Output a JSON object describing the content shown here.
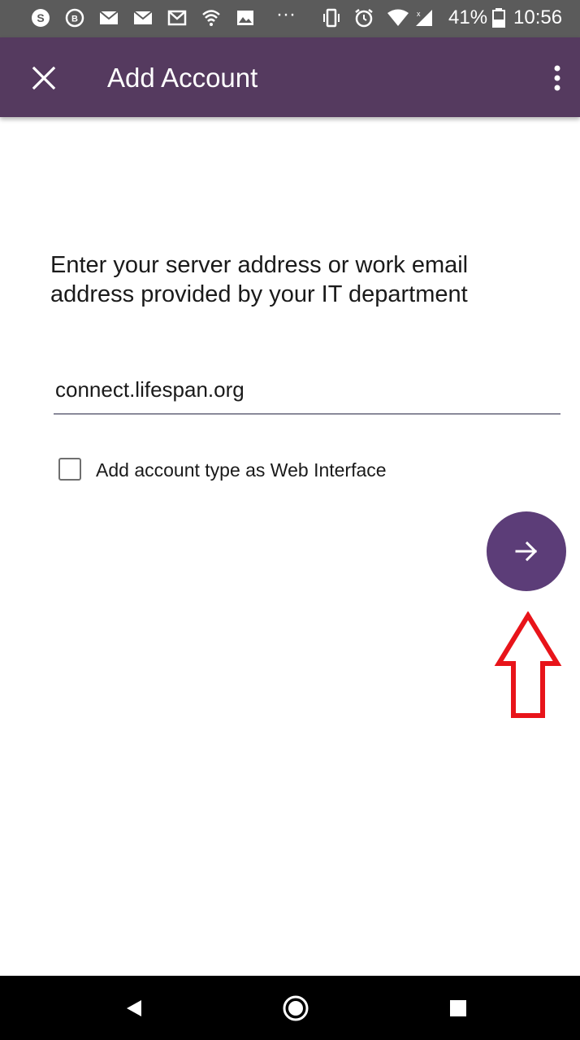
{
  "status_bar": {
    "battery": "41%",
    "time": "10:56",
    "icons": [
      "skype-icon",
      "circle-b-icon",
      "mail-icon",
      "mail-icon",
      "gmail-icon",
      "wifi-icon",
      "image-icon",
      "more-dots-icon",
      "vibrate-icon",
      "alarm-icon",
      "wifi-signal-icon",
      "cell-signal-icon",
      "battery-icon"
    ]
  },
  "app_bar": {
    "title": "Add Account",
    "close_icon": "close-icon",
    "more_icon": "more-vert-icon"
  },
  "main": {
    "instructions": "Enter your server address or work email address provided by your IT department",
    "server_input_value": "connect.lifespan.org",
    "checkbox_label": "Add account type as Web Interface",
    "checkbox_checked": false,
    "next_icon": "arrow-right-icon"
  },
  "colors": {
    "app_bar": "#553a5f",
    "fab": "#5c3d78",
    "annotation": "#e8141a",
    "status_bar": "#5b5b5b",
    "nav_bar": "#000000"
  },
  "nav_bar": {
    "icons": [
      "back-icon",
      "home-icon",
      "recents-icon"
    ]
  }
}
